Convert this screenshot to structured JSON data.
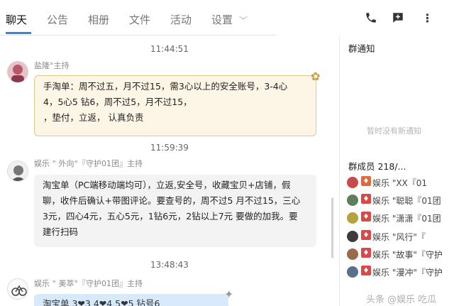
{
  "tabs": [
    {
      "label": "聊天",
      "active": true
    },
    {
      "label": "公告",
      "active": false
    },
    {
      "label": "相册",
      "active": false
    },
    {
      "label": "文件",
      "active": false
    },
    {
      "label": "活动",
      "active": false
    },
    {
      "label": "设置",
      "active": false
    }
  ],
  "tab_dropdown_icon": "chevron-down",
  "toolbar_icons": [
    "phone-icon",
    "add-chat-icon",
    "more-icon"
  ],
  "messages": [
    {
      "time": "11:44:51",
      "sender": "盐隆°主持",
      "lines": [
        "手淘单：周不过五，月不过15，需3心以上的安全账号，3-4心",
        "4，5心5 钻6，周不过5，月不过15，",
        "，垫付，立返， 认真负责"
      ],
      "style": "gold"
    },
    {
      "time": "11:59:39",
      "sender": "娱乐 ° 外向°『守护01团』主持",
      "lines": [
        "淘宝单（PC端移动端均可），立返,安全号，收藏宝贝+店铺，假",
        "聊，收件后确认+带图评论。要查号的，周不过5 月不过15，三心",
        "3元，四心4元，五心5元，1钻6元，2钻以上7元 要做的加我。要",
        "建行扫码"
      ],
      "style": "gray"
    },
    {
      "time": "13:48:43",
      "sender": "娱乐 ° 美萃°『守护01团』主持",
      "lines": [
        "淘宝单 3❤3 4❤4 5❤5 钻号6"
      ],
      "style": "blue"
    }
  ],
  "sidebar": {
    "notice_title": "群通知",
    "notice_empty": "暂时没有新通知",
    "members_title": "群成员 218/...",
    "members": [
      {
        "name": "娱乐 \"XX『01",
        "color": "#c94a4a",
        "role_color": "#e06b3a"
      },
      {
        "name": "娱乐 \"聪聪『01团",
        "color": "#5a7f5a",
        "role_color": "#d84a4a"
      },
      {
        "name": "娱乐 \"潇潇『01团",
        "color": "#b5a13e",
        "role_color": "#d84a4a"
      },
      {
        "name": "娱乐 \"风行\"『",
        "color": "#3c3c3c",
        "role_color": "#d84a4a"
      },
      {
        "name": "娱乐 \"故事\"『守护",
        "color": "#9a6a4a",
        "role_color": "#d84a4a"
      },
      {
        "name": "娱乐 \"漫冲\"『守护",
        "color": "#5b6f8a",
        "role_color": "#d84a4a"
      }
    ]
  },
  "watermark": "头条 @娱乐 吃瓜"
}
